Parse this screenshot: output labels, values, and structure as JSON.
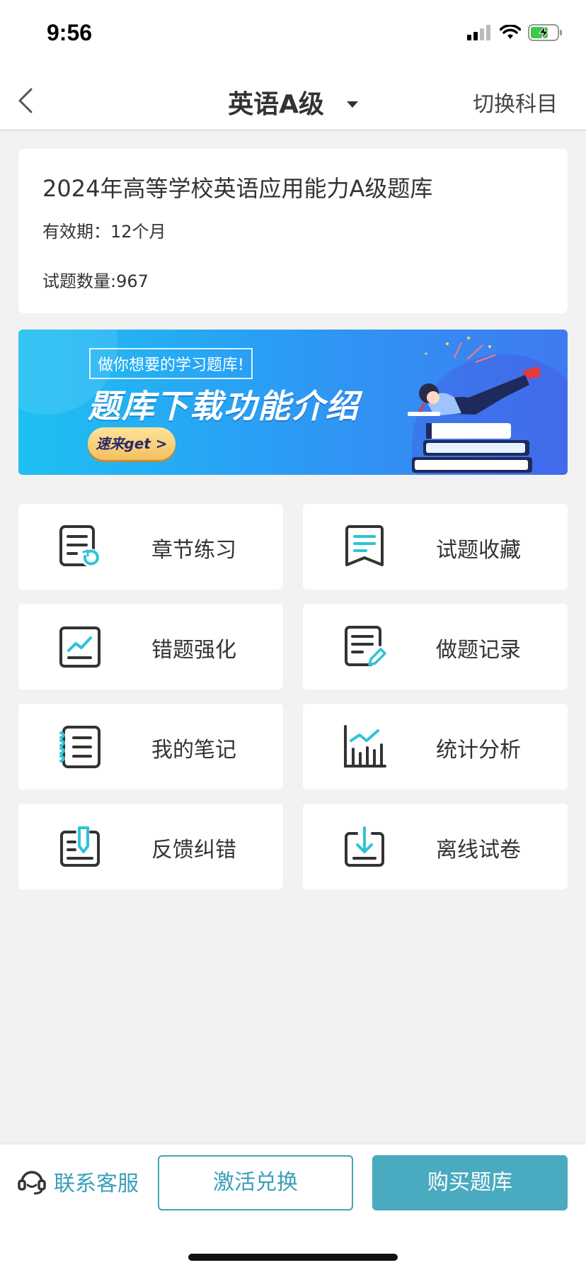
{
  "status_bar": {
    "time": "9:56"
  },
  "nav": {
    "title": "英语A级",
    "switch_label": "切换科目"
  },
  "info": {
    "title": "2024年高等学校英语应用能力A级题库",
    "validity": "有效期：12个月",
    "question_count": "试题数量:967"
  },
  "banner": {
    "tag": "做你想要的学习题库!",
    "title": "题库下载功能介绍",
    "button": "速来get >"
  },
  "menu": [
    {
      "label": "章节练习",
      "icon": "chapter-practice-icon"
    },
    {
      "label": "试题收藏",
      "icon": "bookmark-icon"
    },
    {
      "label": "错题强化",
      "icon": "wrong-question-chart-icon"
    },
    {
      "label": "做题记录",
      "icon": "record-edit-icon"
    },
    {
      "label": "我的笔记",
      "icon": "notebook-icon"
    },
    {
      "label": "统计分析",
      "icon": "statistics-chart-icon"
    },
    {
      "label": "反馈纠错",
      "icon": "feedback-icon"
    },
    {
      "label": "离线试卷",
      "icon": "download-icon"
    }
  ],
  "bottom": {
    "customer_service": "联系客服",
    "activate": "激活兑换",
    "buy": "购买题库"
  },
  "colors": {
    "accent": "#4aaabf",
    "icon_teal": "#2ec4d6",
    "icon_dark": "#333333"
  }
}
